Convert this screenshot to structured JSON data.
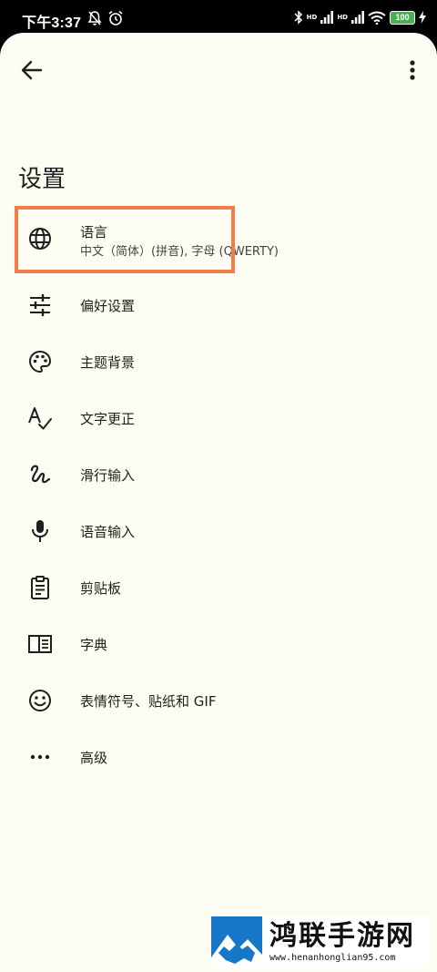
{
  "status": {
    "time": "下午3:37",
    "battery": "100",
    "hd1": "HD",
    "hd2": "HD"
  },
  "page": {
    "title": "设置"
  },
  "items": [
    {
      "label": "语言",
      "sub": "中文（简体）(拼音), 字母 (QWERTY)",
      "icon": "globe-icon"
    },
    {
      "label": "偏好设置",
      "icon": "sliders-icon"
    },
    {
      "label": "主题背景",
      "icon": "palette-icon"
    },
    {
      "label": "文字更正",
      "icon": "spellcheck-icon"
    },
    {
      "label": "滑行输入",
      "icon": "gesture-icon"
    },
    {
      "label": "语音输入",
      "icon": "mic-icon"
    },
    {
      "label": "剪贴板",
      "icon": "clipboard-icon"
    },
    {
      "label": "字典",
      "icon": "book-icon"
    },
    {
      "label": "表情符号、贴纸和 GIF",
      "icon": "emoji-icon"
    },
    {
      "label": "高级",
      "icon": "more-horiz-icon"
    }
  ],
  "watermark": {
    "title": "鸿联手游网",
    "url": "www.henanhonglian95.com"
  },
  "colors": {
    "background": "#fdfcf2",
    "highlight": "#f47c48",
    "text": "#1f1f1f"
  }
}
